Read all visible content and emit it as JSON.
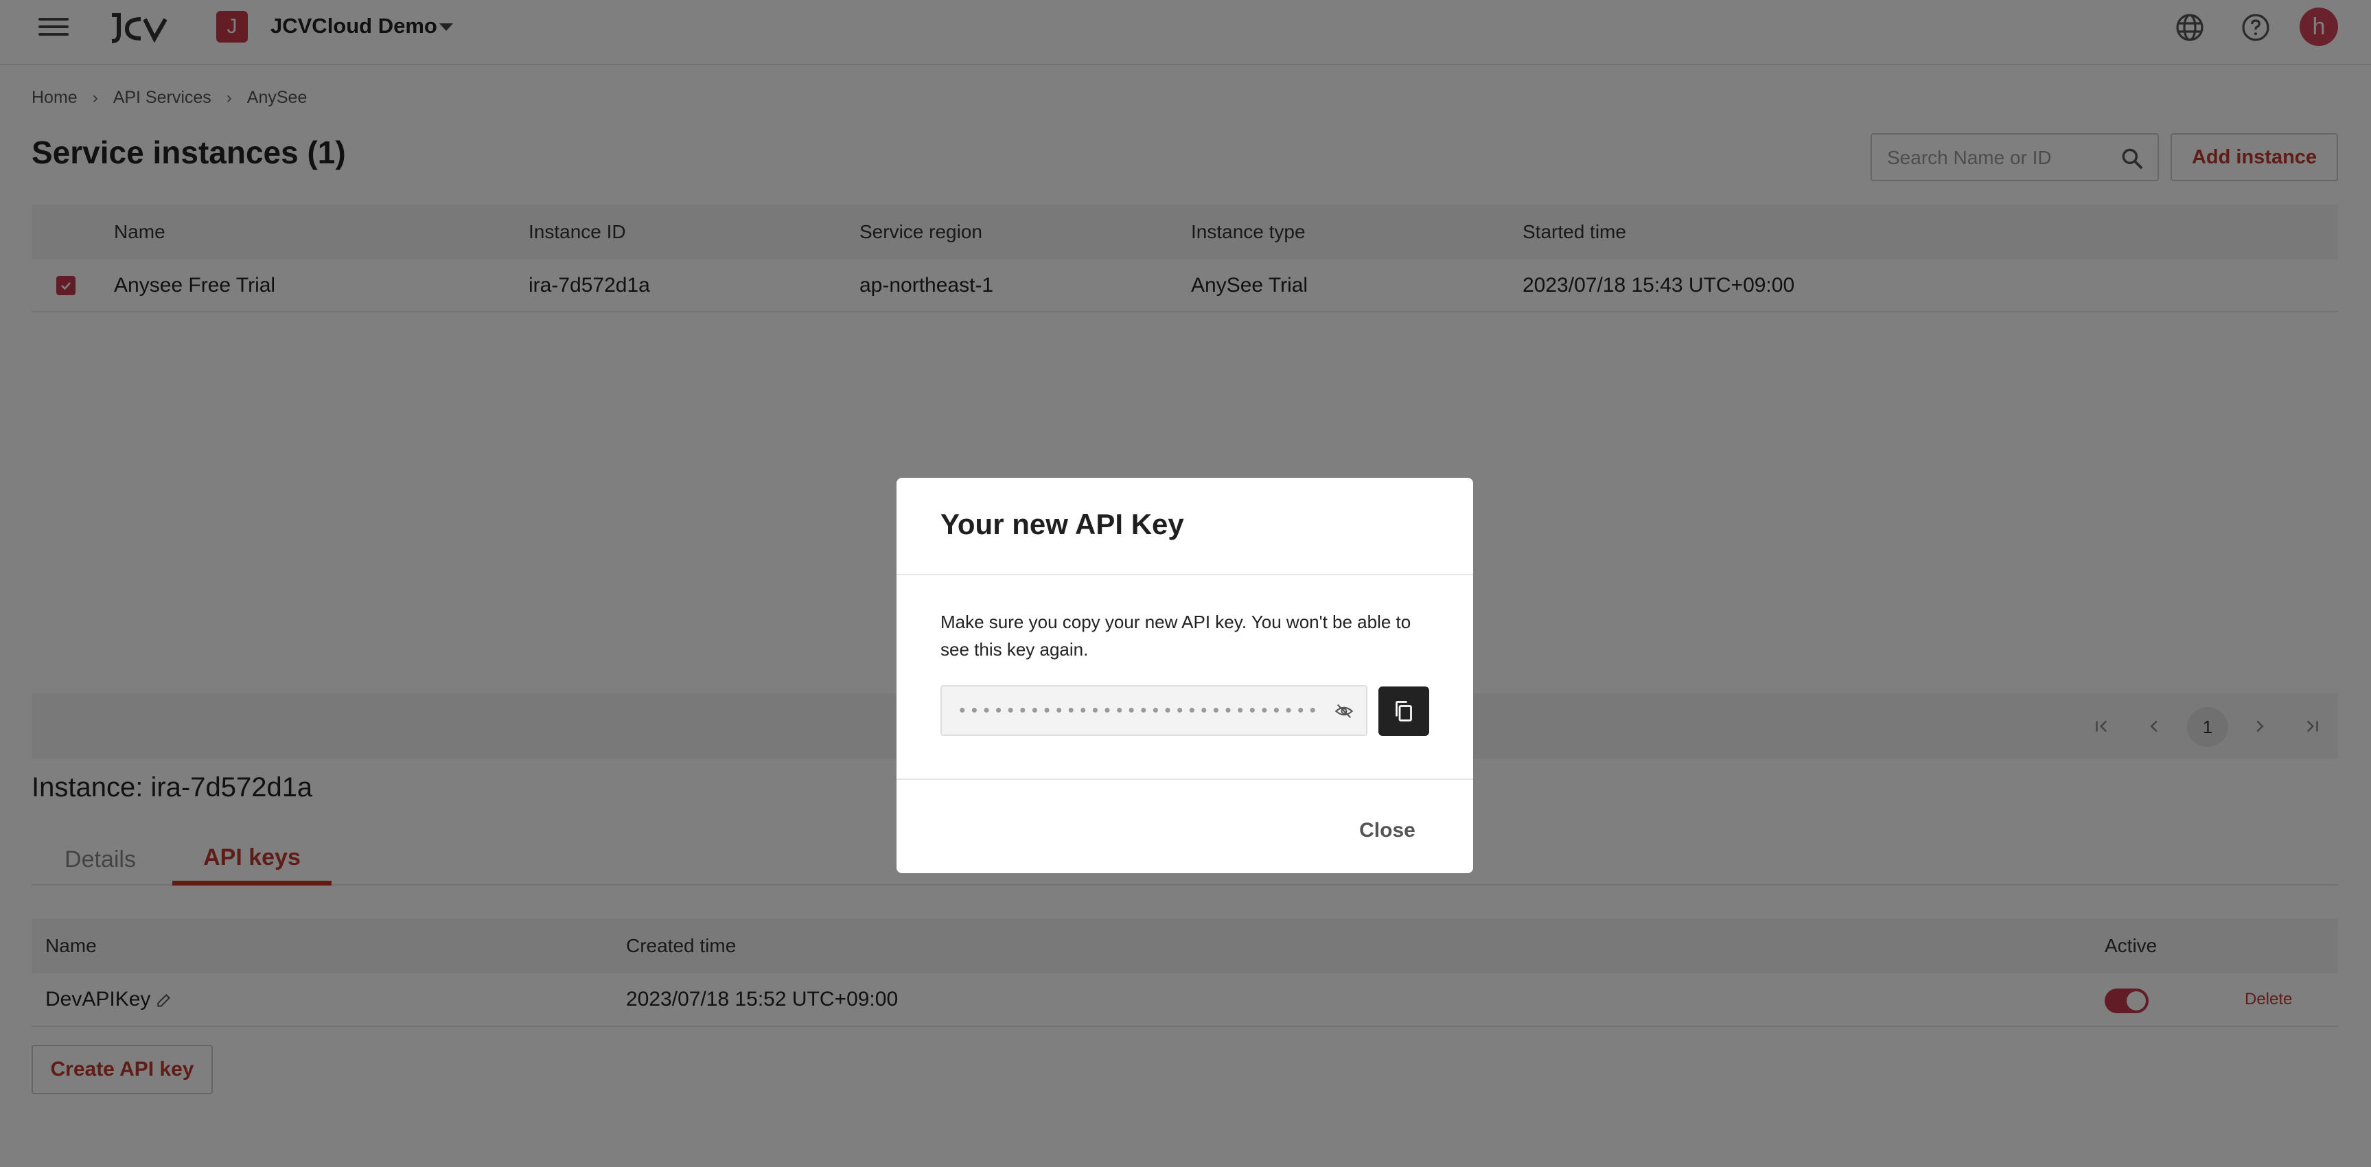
{
  "header": {
    "logo_text": "JCV",
    "project_initial": "J",
    "project_name": "JCVCloud Demo",
    "user_initial": "h",
    "icons": [
      "menu-icon",
      "globe-icon",
      "help-icon"
    ]
  },
  "breadcrumb": [
    "Home",
    "API Services",
    "AnySee"
  ],
  "page": {
    "title": "Service instances (1)",
    "search_placeholder": "Search Name or ID",
    "add_instance_label": "Add instance"
  },
  "instances": {
    "columns": [
      "Name",
      "Instance ID",
      "Service region",
      "Instance type",
      "Started time"
    ],
    "rows": [
      {
        "selected": true,
        "name": "Anysee Free Trial",
        "instance_id": "ira-7d572d1a",
        "region": "ap-northeast-1",
        "type": "AnySee Trial",
        "started": "2023/07/18 15:43 UTC+09:00"
      }
    ]
  },
  "pagination": {
    "current_page": "1"
  },
  "instance_detail": {
    "title": "Instance: ira-7d572d1a",
    "tabs": [
      {
        "label": "Details",
        "active": false
      },
      {
        "label": "API keys",
        "active": true
      }
    ]
  },
  "api_keys": {
    "columns": [
      "Name",
      "Created time",
      "Active"
    ],
    "rows": [
      {
        "name": "DevAPIKey",
        "created": "2023/07/18 15:52 UTC+09:00",
        "active": true,
        "delete_label": "Delete"
      }
    ],
    "create_label": "Create API key"
  },
  "modal": {
    "title": "Your new API Key",
    "message": "Make sure you copy your new API key. You won't be able to see this key again.",
    "masked_key": "••••••••••••••••••••••••••••••••••",
    "close_label": "Close"
  },
  "colors": {
    "accent": "#c1392f",
    "overlay": "rgba(0,0,0,0.5)"
  }
}
